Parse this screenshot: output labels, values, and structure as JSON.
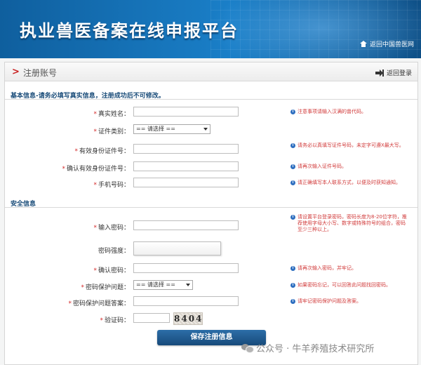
{
  "header": {
    "title": "执业兽医备案在线申报平台",
    "back_link": "返回中国兽医网",
    "back_icon": "home-icon"
  },
  "panel": {
    "title": "注册账号",
    "logout": "返回登录",
    "logout_icon": "logout-icon"
  },
  "basic": {
    "title": "基本信息-请务必填写真实信息，注册成功后不可修改。",
    "fields": [
      {
        "label": "真实姓名：",
        "value": "",
        "hint": "注意事项请输入汉满的兽代码。"
      },
      {
        "label": "证件类别：",
        "selected": "== 请选择 =="
      },
      {
        "label": "有效身份证件号：",
        "value": "",
        "hint": "请务必以真填写证件号码，未定字可遵X最大写。"
      },
      {
        "label": "确认有效身份证件号：",
        "value": "",
        "hint": "请再次输入证件号码。"
      },
      {
        "label": "手机号码：",
        "value": "",
        "hint": "请正确填写本人联系方式，以便及时获知通知。"
      }
    ]
  },
  "security": {
    "title": "安全信息",
    "fields": [
      {
        "label": "输入密码：",
        "value": "",
        "hint": "请设置平台登录密码，密码长度为8-20位字符，推荐使用字母大小写、数字或特殊符号的组合，密码至少三种以上。"
      },
      {
        "label": "密码强度：",
        "value": ""
      },
      {
        "label": "确认密码：",
        "value": "",
        "hint": "请再次输入密码，并牢记。"
      },
      {
        "label": "密码保护问题：",
        "selected": "== 请选择 ==",
        "hint": "如果密码忘记，可以回答此问题找回密码。"
      },
      {
        "label": "密码保护问题答案：",
        "value": "",
        "hint": "请牢记密码保护问题及答案。"
      },
      {
        "label": "验证码：",
        "value": "",
        "captcha": "8404"
      }
    ]
  },
  "submit_label": "保存注册信息",
  "watermark": "公众号 · 牛羊养殖技术研究所",
  "colors": {
    "accent": "#1a6fb3",
    "required": "#d42a2a",
    "hint": "#d13b3b"
  }
}
